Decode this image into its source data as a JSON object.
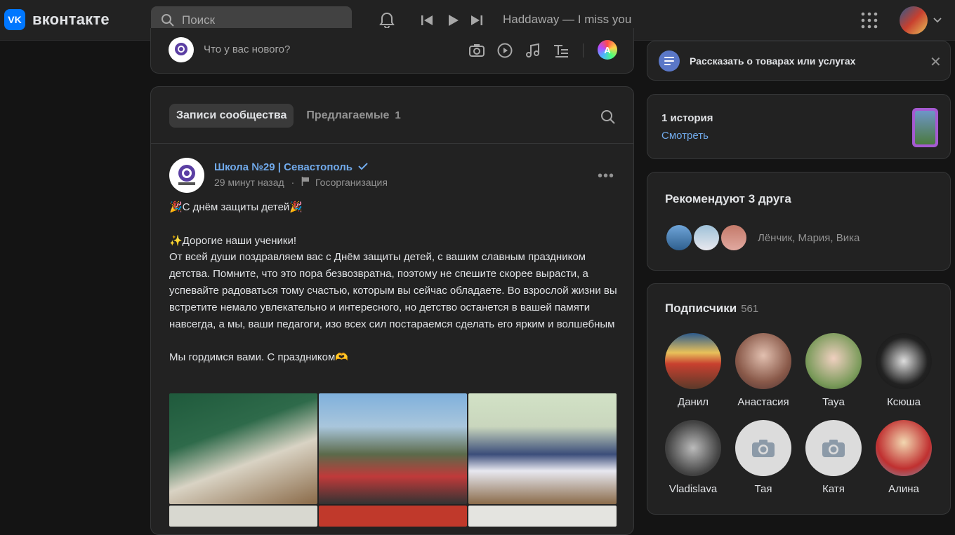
{
  "header": {
    "logo_mark": "VK",
    "logo_text": "вконтакте",
    "search_placeholder": "Поиск",
    "now_playing": "Haddaway — I miss you"
  },
  "composer": {
    "placeholder": "Что у вас нового?"
  },
  "feed": {
    "tab_active": "Записи сообщества",
    "tab_suggested": "Предлагаемые",
    "suggested_count": "1"
  },
  "post": {
    "author": "Школа №29 | Севастополь",
    "time": "29 минут назад",
    "category": "Госорганизация",
    "line1": "🎉С днём защиты детей🎉",
    "line2": "✨Дорогие наши ученики!",
    "paragraph": "От всей души поздравляем вас с Днём защиты детей, с вашим славным праздником детства. Помните, что это пора безвозвратна, поэтому не спешите скорее вырасти, а успевайте радоваться тому счастью, которым вы сейчас обладаете. Во взрослой жизни вы встретите немало увлекательно и интересного, но детство останется в вашей памяти навсегда, а мы, ваши педагоги, изо всех сил постараемся сделать его ярким и волшебным",
    "closing": "Мы гордимся вами. С праздником🫶"
  },
  "sidebar": {
    "promo_text": "Рассказать о товарах или услугах",
    "stories_title": "1 история",
    "stories_link": "Смотреть",
    "friends_title": "Рекомендуют 3 друга",
    "friends_names": "Лёнчик, Мария, Вика",
    "subs_title": "Подписчики",
    "subs_count": "561",
    "subscribers": [
      "Данил",
      "Анастасия",
      "Taya",
      "Ксюша",
      "Vladislava",
      "Тая",
      "Катя",
      "Алина"
    ]
  },
  "colors": {
    "accent": "#71aaeb",
    "brand": "#0077ff",
    "background": "#141414",
    "card": "#222222"
  }
}
